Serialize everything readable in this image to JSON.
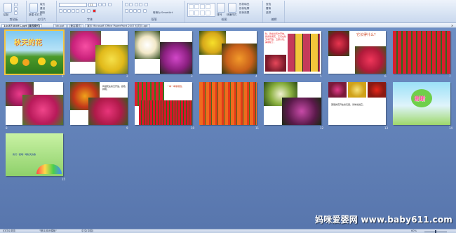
{
  "ribbon": {
    "groups": [
      {
        "id": "clipboard",
        "label": "剪贴板"
      },
      {
        "id": "slides",
        "label": "幻灯片"
      },
      {
        "id": "font",
        "label": "字体"
      },
      {
        "id": "paragraph",
        "label": "段落"
      },
      {
        "id": "drawing",
        "label": "绘图"
      },
      {
        "id": "editing",
        "label": "编辑"
      }
    ],
    "paste_label": "粘贴",
    "new_slide_label": "新建\n幻灯片",
    "layout_label": "版式",
    "reset_label": "重设",
    "delete_label": "删除",
    "font_size_value": "11",
    "smartart_label": "转换为 SmartArt",
    "arrange_label": "排列",
    "quick_styles_label": "快速样式",
    "shape_fill_label": "形状填充",
    "shape_outline_label": "形状轮廓",
    "shape_effects_label": "形状效果",
    "find_label": "查找",
    "replace_label": "替换",
    "select_label": "选择"
  },
  "tabs": [
    {
      "label": "1448748491.ppt [兼容模式]",
      "active": true
    },
    {
      "label": "lab.ppt",
      "active": false
    },
    {
      "label": "[兼容模式]",
      "active": false
    },
    {
      "label": "演示 Microsoft Office PowerPoint 2007 幻灯片.ppt",
      "active": false
    }
  ],
  "slides": [
    {
      "num": "1",
      "title": "秋天的花"
    },
    {
      "num": "2"
    },
    {
      "num": "3"
    },
    {
      "num": "4"
    },
    {
      "num": "5",
      "text": "秋，我在秋天中开放，我喜欢菊花，它们在秋天中开放，五颜六色，美丽极了。"
    },
    {
      "num": "6",
      "text": "它长得什么？"
    },
    {
      "num": "7"
    },
    {
      "num": "8"
    },
    {
      "num": "9",
      "text": "鸡冠花在秋天开放，颜色鲜艳。"
    },
    {
      "num": "10",
      "text": "一串一串像鞭炮。"
    },
    {
      "num": "11"
    },
    {
      "num": "12"
    },
    {
      "num": "13",
      "text": "美丽的花开在秋天里，请你说说它。"
    },
    {
      "num": "14",
      "title": "谢谢"
    },
    {
      "num": "15",
      "text": "我们一起唱一唱秋天的歌"
    }
  ],
  "status": {
    "slide_sorter": "幻灯片浏览",
    "theme": "\"默认设计模板\"",
    "language": "中文(中国)",
    "zoom": "60%"
  },
  "watermark": "妈咪爱婴网 www.baby611.com",
  "colors": {
    "sorter_bg": "#6d8ec4",
    "selected_outline": "#f4c542"
  }
}
